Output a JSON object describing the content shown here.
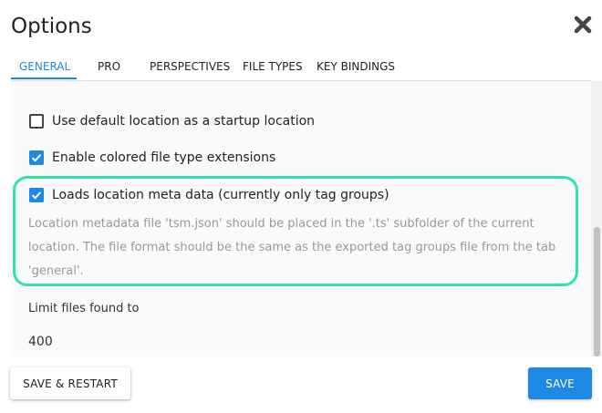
{
  "dialog": {
    "title": "Options",
    "close_icon": "close-icon"
  },
  "tabs": [
    {
      "label": "GENERAL",
      "active": true
    },
    {
      "label": "PRO",
      "active": false
    },
    {
      "label": "PERSPECTIVES",
      "active": false
    },
    {
      "label": "FILE TYPES",
      "active": false
    },
    {
      "label": "KEY BINDINGS",
      "active": false
    }
  ],
  "settings": {
    "default_location": {
      "label": "Use default location as a startup location",
      "checked": false
    },
    "colored_extensions": {
      "label": "Enable colored file type extensions",
      "checked": true
    },
    "location_meta": {
      "label": "Loads location meta data (currently only tag groups)",
      "checked": true,
      "hint": "Location metadata file 'tsm.json' should be placed in the '.ts' subfolder of the current location. The file format should be the same as the exported tag groups file from the tab 'general'."
    },
    "limit_files": {
      "label": "Limit files found to",
      "value": "400"
    }
  },
  "footer": {
    "restart_label": "SAVE & RESTART",
    "save_label": "SAVE"
  },
  "colors": {
    "accent": "#1e88e5",
    "highlight": "#2ee6a0"
  }
}
